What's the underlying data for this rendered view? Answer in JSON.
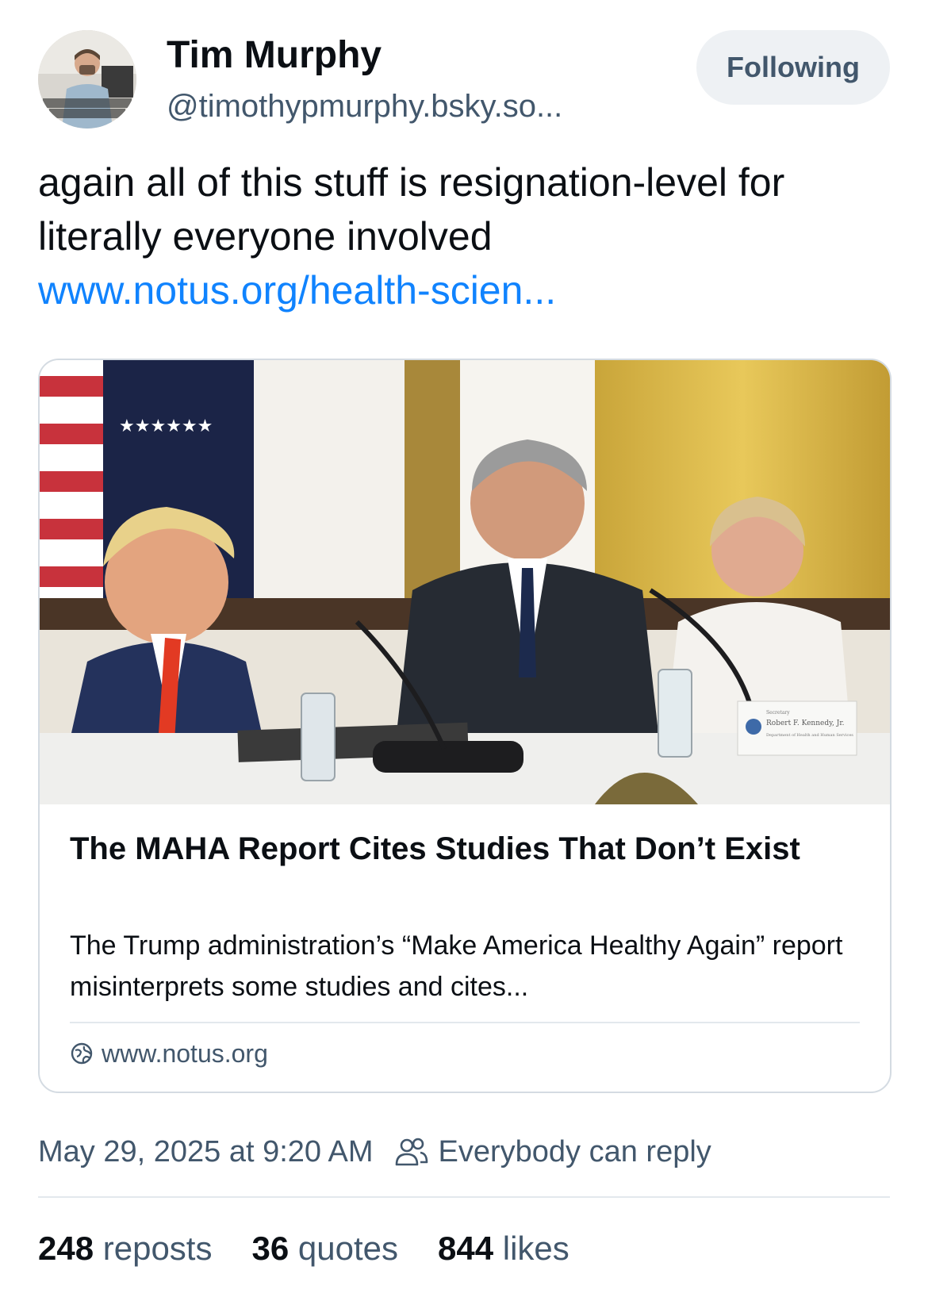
{
  "author": {
    "name": "Tim Murphy",
    "handle": "@timothypmurphy.bsky.so...",
    "avatar_caption": "TIMOTHY \"TIM\" MURPHY SENIOR REPORTER"
  },
  "follow_button": {
    "label": "Following"
  },
  "post": {
    "text": "again all of this stuff is resignation-level for literally everyone involved",
    "link_text": "www.notus.org/health-scien..."
  },
  "link_card": {
    "title": "The MAHA Report Cites Studies That Don’t Exist",
    "description": "The Trump administration’s “Make America Healthy Again” report misinterprets some studies and cites...",
    "domain": "www.notus.org",
    "domain_icon": "globe-icon",
    "image": {
      "placard_title": "Secretary",
      "placard_name": "Robert F. Kennedy, Jr.",
      "placard_dept": "Department of Health and Human Services"
    }
  },
  "meta": {
    "timestamp": "May 29, 2025 at 9:20 AM",
    "reply_setting": "Everybody can reply",
    "reply_icon": "people-icon"
  },
  "stats": {
    "reposts_count": "248",
    "reposts_label": "reposts",
    "quotes_count": "36",
    "quotes_label": "quotes",
    "likes_count": "844",
    "likes_label": "likes"
  },
  "colors": {
    "link": "#1083fe",
    "secondary_text": "#42576c",
    "primary_text": "#0b0f14",
    "button_bg": "#eef1f4",
    "border": "#d4dbe2"
  }
}
